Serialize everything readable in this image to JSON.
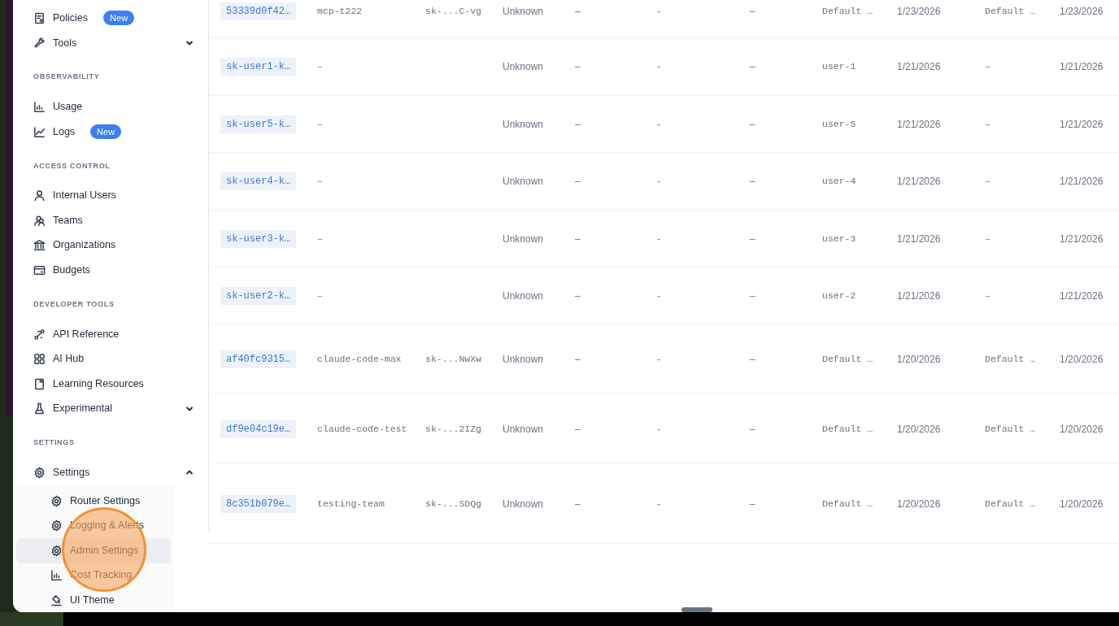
{
  "sidebar": {
    "groups": [
      {
        "items": [
          {
            "label": "Policies",
            "badge": "New"
          },
          {
            "label": "Tools",
            "expanded": false
          }
        ]
      },
      {
        "heading": "OBSERVABILITY",
        "items": [
          {
            "label": "Usage"
          },
          {
            "label": "Logs",
            "badge": "New"
          }
        ]
      },
      {
        "heading": "ACCESS CONTROL",
        "items": [
          {
            "label": "Internal Users"
          },
          {
            "label": "Teams"
          },
          {
            "label": "Organizations"
          },
          {
            "label": "Budgets"
          }
        ]
      },
      {
        "heading": "DEVELOPER TOOLS",
        "items": [
          {
            "label": "API Reference"
          },
          {
            "label": "AI Hub"
          },
          {
            "label": "Learning Resources"
          },
          {
            "label": "Experimental",
            "expanded": false
          }
        ]
      },
      {
        "heading": "SETTINGS",
        "items": [
          {
            "label": "Settings",
            "expanded": true,
            "children": [
              {
                "label": "Router Settings",
                "selected": false
              },
              {
                "label": "Logging & Alerts",
                "selected": false
              },
              {
                "label": "Admin Settings",
                "selected": true
              },
              {
                "label": "Cost Tracking",
                "selected": false
              },
              {
                "label": "UI Theme",
                "selected": false
              }
            ]
          }
        ]
      }
    ]
  },
  "table": {
    "rows": [
      {
        "column_1": "53339d0f42…",
        "column_2": "mcp-t222",
        "column_3": "sk-...C-vg",
        "column_4": "Unknown",
        "column_5": "–",
        "column_6": "-",
        "column_7": "–",
        "column_8": "Default …",
        "column_9": "1/23/2026",
        "column_10": "Default …",
        "column_11": "1/23/2026"
      },
      {
        "column_1": "sk-user1-k…",
        "column_2": "–",
        "column_4": "Unknown",
        "column_5": "–",
        "column_6": "-",
        "column_7": "–",
        "column_8": "user-1",
        "column_9": "1/21/2026",
        "column_10": "–",
        "column_11": "1/21/2026"
      },
      {
        "column_1": "sk-user5-k…",
        "column_2": "–",
        "column_4": "Unknown",
        "column_5": "–",
        "column_6": "-",
        "column_7": "–",
        "column_8": "user-5",
        "column_9": "1/21/2026",
        "column_10": "–",
        "column_11": "1/21/2026"
      },
      {
        "column_1": "sk-user4-k…",
        "column_2": "–",
        "column_4": "Unknown",
        "column_5": "–",
        "column_6": "-",
        "column_7": "–",
        "column_8": "user-4",
        "column_9": "1/21/2026",
        "column_10": "–",
        "column_11": "1/21/2026"
      },
      {
        "column_1": "sk-user3-k…",
        "column_2": "–",
        "column_4": "Unknown",
        "column_5": "–",
        "column_6": "-",
        "column_7": "–",
        "column_8": "user-3",
        "column_9": "1/21/2026",
        "column_10": "–",
        "column_11": "1/21/2026"
      },
      {
        "column_1": "sk-user2-k…",
        "column_2": "–",
        "column_4": "Unknown",
        "column_5": "–",
        "column_6": "-",
        "column_7": "–",
        "column_8": "user-2",
        "column_9": "1/21/2026",
        "column_10": "–",
        "column_11": "1/21/2026"
      },
      {
        "column_1": "af40fc9315…",
        "column_2": "claude-code-max",
        "column_3": "sk-...NwXw",
        "column_4": "Unknown",
        "column_5": "–",
        "column_6": "-",
        "column_7": "–",
        "column_8": "Default …",
        "column_9": "1/20/2026",
        "column_10": "Default …",
        "column_11": "1/20/2026"
      },
      {
        "column_1": "df9e04c19e…",
        "column_2": "claude-code-test",
        "column_3": "sk-...2IZg",
        "column_4": "Unknown",
        "column_5": "–",
        "column_6": "-",
        "column_7": "–",
        "column_8": "Default …",
        "column_9": "1/20/2026",
        "column_10": "Default …",
        "column_11": "1/20/2026"
      },
      {
        "column_1": "8c351b079e…",
        "column_2": "testing-team",
        "column_3": "sk-...SDQg",
        "column_4": "Unknown",
        "column_5": "–",
        "column_6": "-",
        "column_7": "–",
        "column_8": "Default …",
        "column_9": "1/20/2026",
        "column_10": "Default …",
        "column_11": "1/20/2026"
      }
    ]
  }
}
